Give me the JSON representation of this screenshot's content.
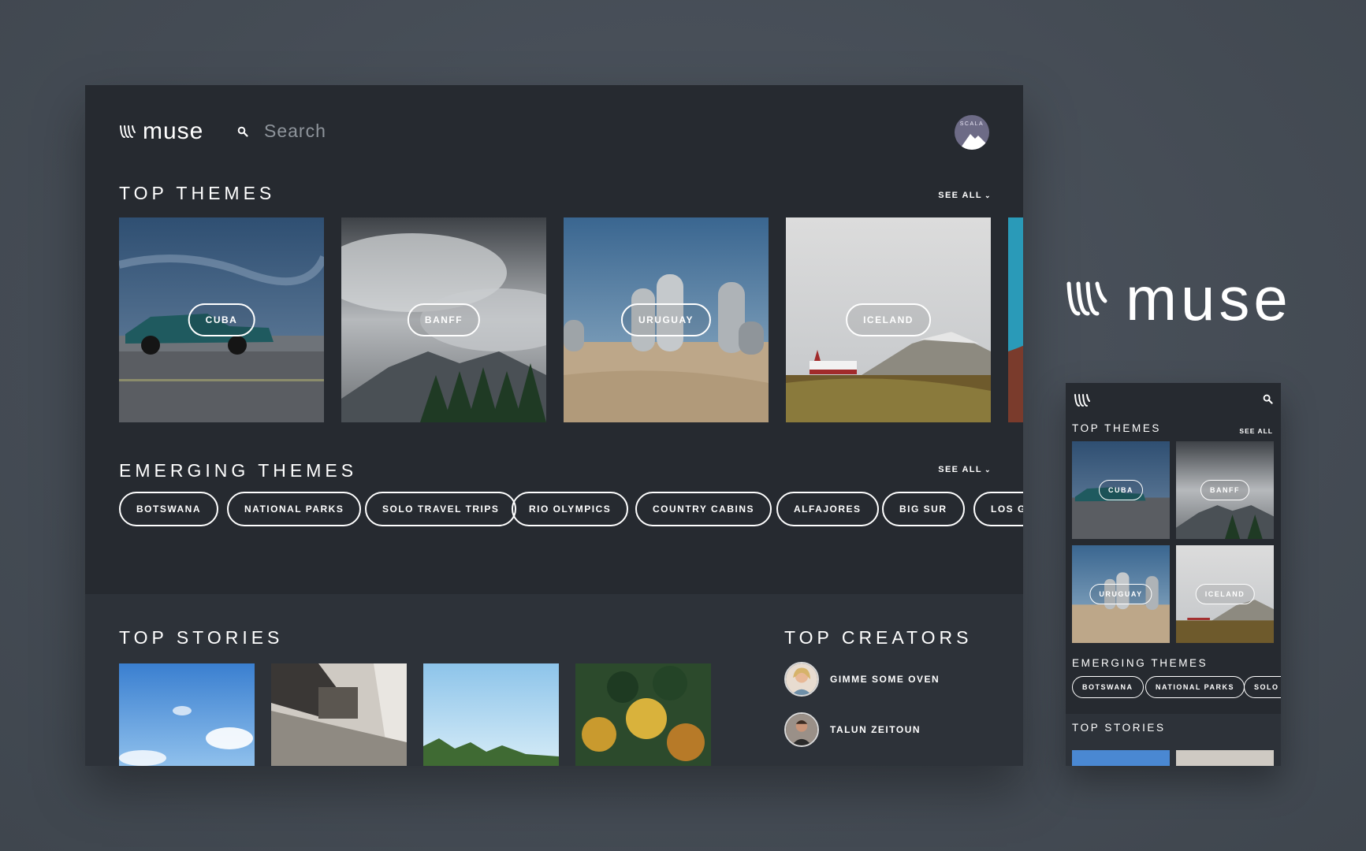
{
  "app": {
    "logo_text": "muse",
    "logo_icon": "muse-wave-icon",
    "avatar_text": "SCALA"
  },
  "search": {
    "placeholder": "Search"
  },
  "top_themes": {
    "title": "TOP THEMES",
    "see_all": "SEE ALL",
    "cards": [
      {
        "label": "CUBA",
        "scene": "car-on-road"
      },
      {
        "label": "BANFF",
        "scene": "cloudy-mountain"
      },
      {
        "label": "URUGUAY",
        "scene": "hand-sculpture-beach"
      },
      {
        "label": "ICELAND",
        "scene": "church-mountain"
      }
    ]
  },
  "emerging_themes": {
    "title": "EMERGING THEMES",
    "see_all": "SEE ALL",
    "tags": [
      "BOTSWANA",
      "NATIONAL PARKS",
      "SOLO TRAVEL TRIPS",
      "RIO OLYMPICS",
      "COUNTRY CABINS",
      "ALFAJORES",
      "BIG SUR",
      "LOS GL"
    ]
  },
  "top_stories": {
    "title": "TOP STORIES",
    "items": [
      {
        "scene": "blue-sky"
      },
      {
        "scene": "train-interior"
      },
      {
        "scene": "sky-trees"
      },
      {
        "scene": "autumn-forest"
      }
    ]
  },
  "top_creators": {
    "title": "TOP CREATORS",
    "items": [
      {
        "name": "GIMME SOME OVEN"
      },
      {
        "name": "TALUN ZEITOUN"
      }
    ]
  },
  "brand": {
    "text": "muse"
  },
  "mobile": {
    "top_themes_title": "TOP THEMES",
    "see_all": "SEE ALL",
    "cards": [
      "CUBA",
      "BANFF",
      "URUGUAY",
      "ICELAND"
    ],
    "emerging_title": "EMERGING THEMES",
    "tags": [
      "BOTSWANA",
      "NATIONAL PARKS",
      "SOLO T"
    ],
    "top_stories_title": "TOP STORIES"
  },
  "colors": {
    "background": "#454c55",
    "panel": "#262a30",
    "panel_lower": "#2d3239",
    "text": "#ffffff",
    "muted": "#8e949b"
  }
}
